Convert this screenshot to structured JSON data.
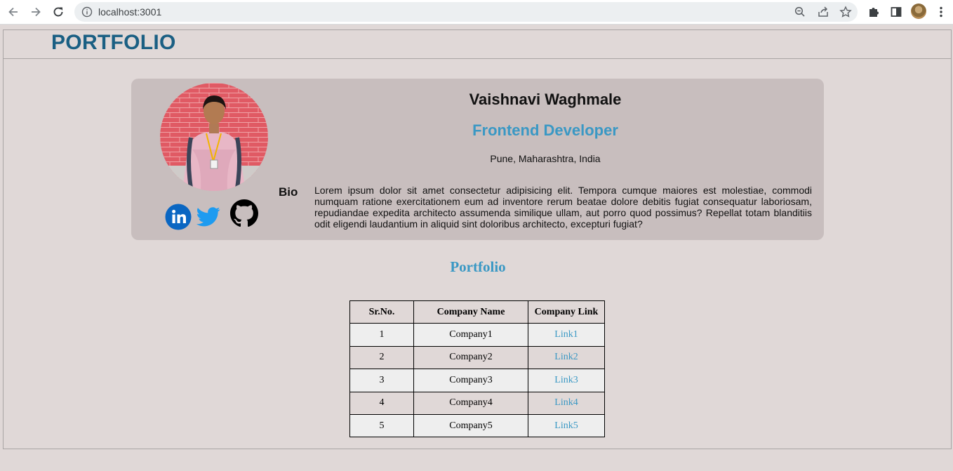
{
  "browser": {
    "url": "localhost:3001"
  },
  "header": {
    "brand": "PORTFOLIO"
  },
  "profile": {
    "name": "Vaishnavi Waghmale",
    "role": "Frontend Developer",
    "location": "Pune, Maharashtra, India",
    "bio_label": "Bio",
    "bio": "Lorem ipsum dolor sit amet consectetur adipisicing elit. Tempora cumque maiores est molestiae, commodi numquam ratione exercitationem eum ad inventore rerum beatae dolore debitis fugiat consequatur laboriosam, repudiandae expedita architecto assumenda similique ullam, aut porro quod possimus? Repellat totam blanditiis odit eligendi laudantium in aliquid sint doloribus architecto, excepturi fugiat?",
    "socials": [
      "linkedin-icon",
      "twitter-icon",
      "github-icon"
    ]
  },
  "portfolio": {
    "title": "Portfolio",
    "columns": [
      "Sr.No.",
      "Company Name",
      "Company Link"
    ],
    "rows": [
      {
        "sr": "1",
        "company": "Company1",
        "link": "Link1"
      },
      {
        "sr": "2",
        "company": "Company2",
        "link": "Link2"
      },
      {
        "sr": "3",
        "company": "Company3",
        "link": "Link3"
      },
      {
        "sr": "4",
        "company": "Company4",
        "link": "Link4"
      },
      {
        "sr": "5",
        "company": "Company5",
        "link": "Link5"
      }
    ]
  },
  "colors": {
    "page_bg": "#e0d8d7",
    "card_bg": "#c8bebe",
    "brand": "#1a5f83",
    "accent": "#3a98c4",
    "linkedin": "#0a66c2",
    "twitter": "#1d9bf0"
  }
}
